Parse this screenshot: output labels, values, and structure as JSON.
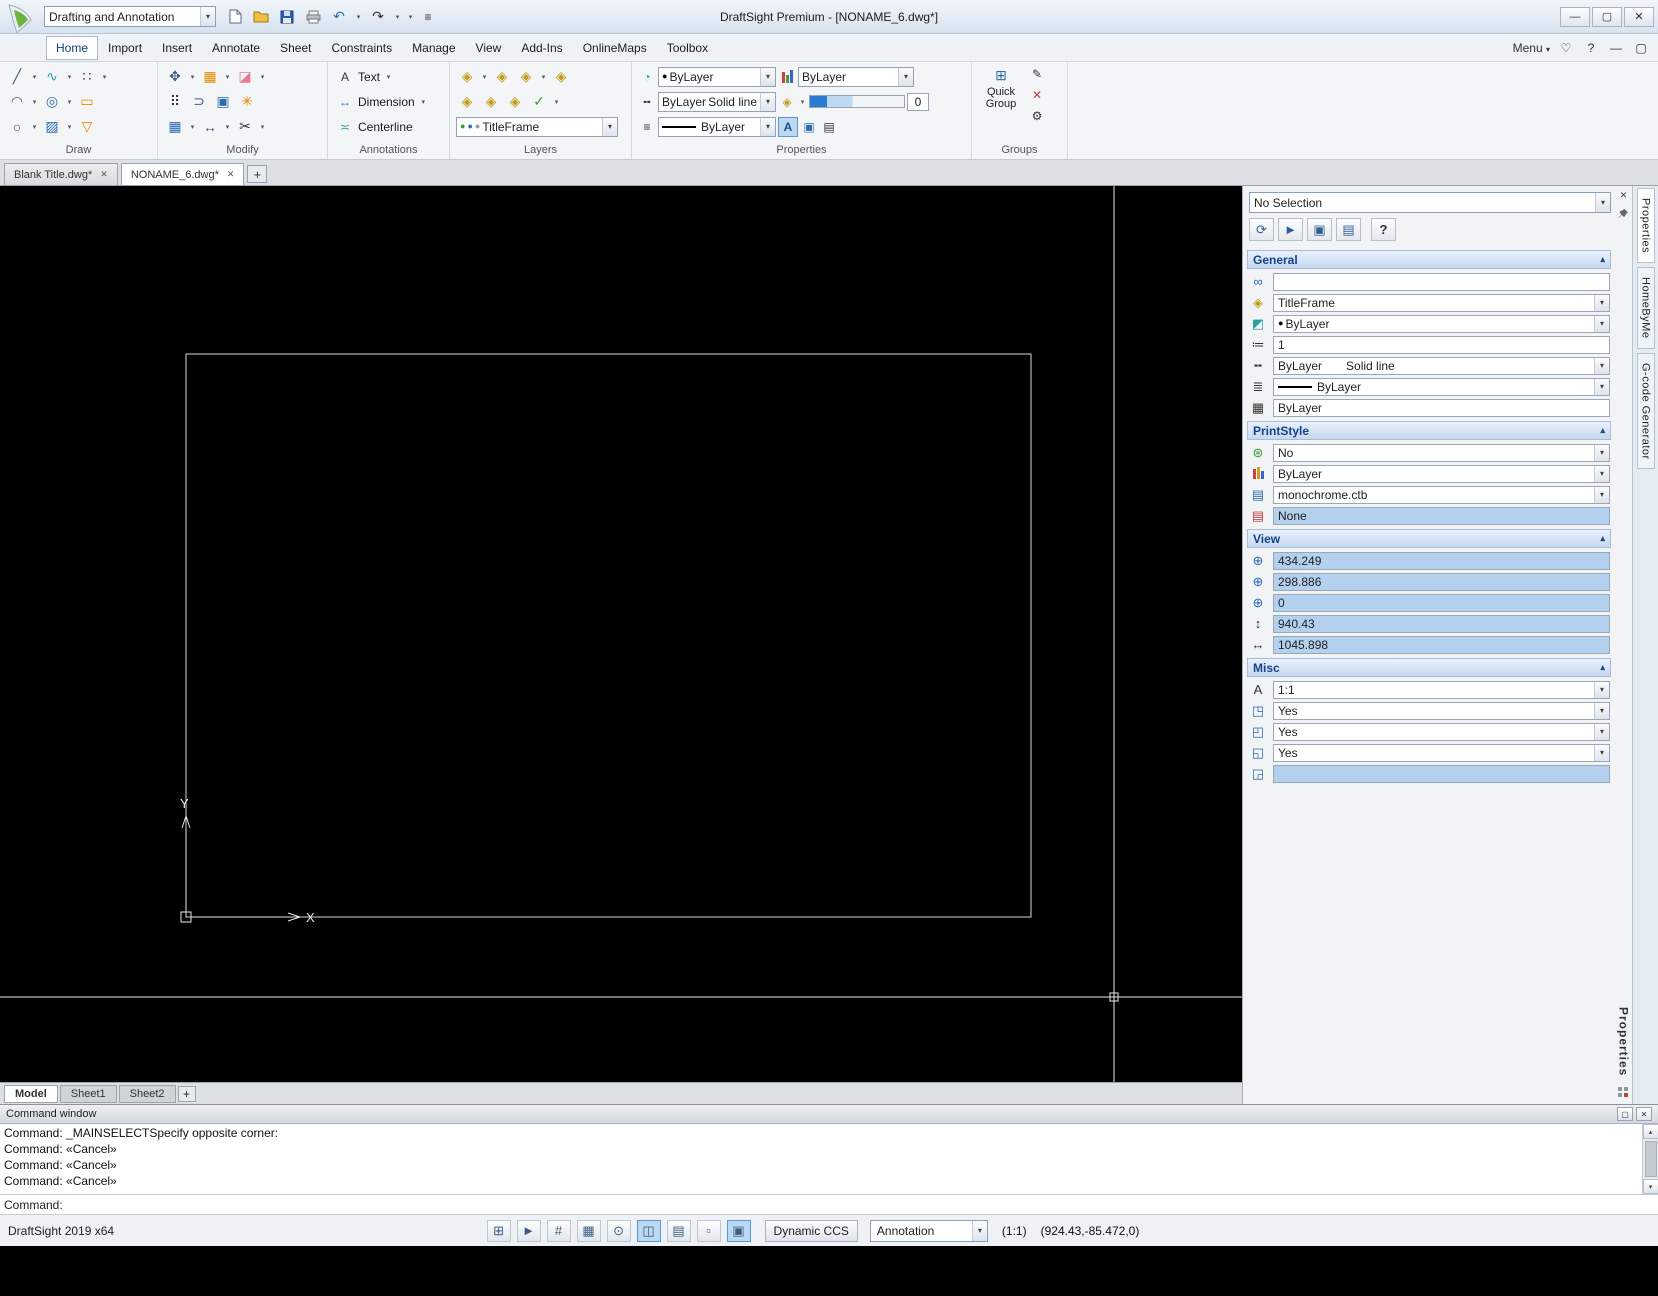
{
  "titlebar": {
    "workspace": "Drafting and Annotation",
    "title": "DraftSight Premium - [NONAME_6.dwg*]"
  },
  "menubar": {
    "tabs": {
      "home": "Home",
      "import": "Import",
      "insert": "Insert",
      "annotate": "Annotate",
      "sheet": "Sheet",
      "constraints": "Constraints",
      "manage": "Manage",
      "view": "View",
      "addins": "Add-Ins",
      "onlinemaps": "OnlineMaps",
      "toolbox": "Toolbox"
    },
    "menu_label": "Menu"
  },
  "ribbon": {
    "draw_label": "Draw",
    "modify_label": "Modify",
    "annotations_label": "Annotations",
    "layers_label": "Layers",
    "properties_label": "Properties",
    "groups_label": "Groups",
    "text_button": "Text",
    "dimension_button": "Dimension",
    "centerline_button": "Centerline",
    "layer_combo": "TitleFrame",
    "color_combo": "ByLayer",
    "lineweight_combo": "ByLayer",
    "linestyle_combo": "ByLayer",
    "linestyle_name": "Solid line",
    "lineweight2_combo": "ByLayer",
    "weight_value": "0",
    "quick_group_button": "Quick Group"
  },
  "doc_tabs": {
    "tab1": "Blank Title.dwg*",
    "tab2": "NONAME_6.dwg*"
  },
  "canvas": {
    "x_label": "X",
    "y_label": "Y"
  },
  "sheets": {
    "model": "Model",
    "sheet1": "Sheet1",
    "sheet2": "Sheet2"
  },
  "props": {
    "selection_combo": "No Selection",
    "general_title": "General",
    "hyperlink_value": "",
    "layer_value": "TitleFrame",
    "color_value": "ByLayer",
    "linescale_value": "1",
    "linestyle_value": "ByLayer",
    "linestyle_name": "Solid line",
    "lineweight_value": "ByLayer",
    "transparency_value": "ByLayer",
    "printstyle_title": "PrintStyle",
    "print_value": "No",
    "printcolor_value": "ByLayer",
    "printstyle_table": "monochrome.ctb",
    "printstyle_none": "None",
    "view_title": "View",
    "center_x": "434.249",
    "center_y": "298.886",
    "center_z": "0",
    "view_height": "940.43",
    "view_width": "1045.898",
    "misc_title": "Misc",
    "annotation_scale": "1:1",
    "yes1": "Yes",
    "yes2": "Yes",
    "yes3": "Yes",
    "blank": ""
  },
  "rail": {
    "tab1": "Properties",
    "tab2": "HomeByMe",
    "tab3": "G-code Generator",
    "bottom": "Properties"
  },
  "command": {
    "window_title": "Command window",
    "line1": "Command: _MAINSELECTSpecify opposite corner:",
    "line2": "Command: «Cancel»",
    "line3": "Command: «Cancel»",
    "line4": "Command: «Cancel»",
    "prompt": "Command:"
  },
  "status": {
    "version": "DraftSight 2019 x64",
    "dynamic_ccs": "Dynamic CCS",
    "annotation_combo": "Annotation",
    "scale": "(1:1)",
    "coords": "(924.43,-85.472,0)"
  },
  "icons": {
    "caret_down": "▾",
    "caret_up": "▴",
    "close": "✕",
    "minimize": "—",
    "restore": "▢",
    "plus": "+",
    "help": "?",
    "heart": "♡",
    "grip": "≡",
    "undo": "↶",
    "redo": "↷",
    "check": "✓",
    "dot": "●",
    "line": "╱",
    "spline": "∿",
    "points": "∷",
    "arc": "◠",
    "circle2": "◎",
    "rectangle": "▭",
    "circle": "○",
    "hatch": "▨",
    "polygon": "▽",
    "move": "✥",
    "array": "▦",
    "erase": "◪",
    "pattern": "⠿",
    "offset": "⊃",
    "window": "▣",
    "explode": "✳",
    "stretch": "↔",
    "trim": "✂",
    "text": "A",
    "dimension": "↔",
    "centerline": "≍",
    "layer": "◈",
    "droplet": "◔",
    "lines3": "≣",
    "lines": "≡",
    "dashes": "╍",
    "transparency": "▦",
    "hyperlink": "∞",
    "colorswatch": "◩",
    "linescale": "≔",
    "table": "▤",
    "globe": "⊛",
    "coord": "⊕",
    "vruler": "↕",
    "hruler": "↔",
    "annoscale": "A",
    "ccs1": "◳",
    "ccs2": "◰",
    "ccs3": "◱",
    "ccs4": "◲",
    "gear": "⚙",
    "pencil": "✎",
    "cursor": "►",
    "snap": "⊞",
    "hash": "#",
    "ortho": "⊙",
    "polar": "◫",
    "esnap": "▫",
    "scroll_up": "▲",
    "scroll_down": "▼",
    "select_cycle": "⟳",
    "list": "▤"
  }
}
